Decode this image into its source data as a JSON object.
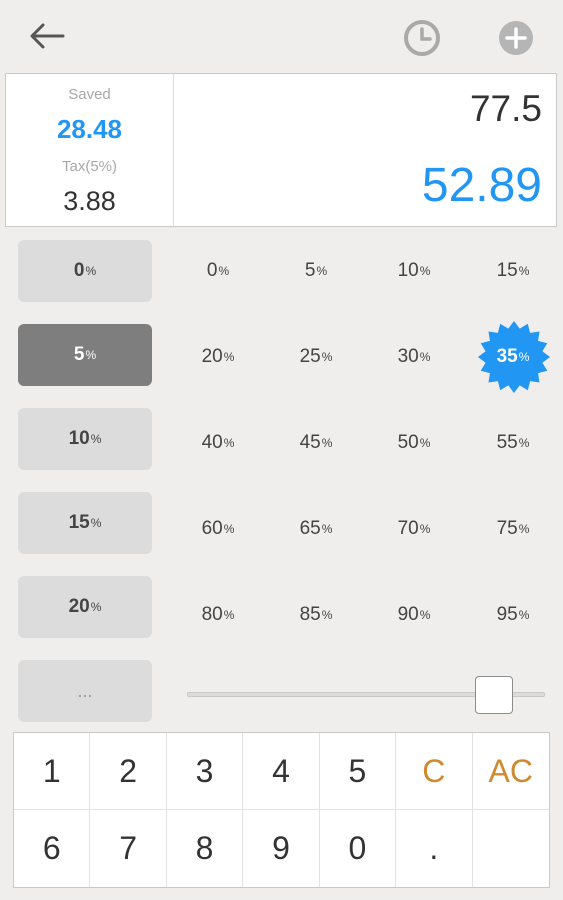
{
  "display": {
    "saved_label": "Saved",
    "saved_value": "28.48",
    "tax_label": "Tax(5%)",
    "tax_value": "3.88",
    "price": "77.5",
    "result": "52.89"
  },
  "tax_rates": [
    {
      "value": "0",
      "unit": "%",
      "selected": false
    },
    {
      "value": "5",
      "unit": "%",
      "selected": true
    },
    {
      "value": "10",
      "unit": "%",
      "selected": false
    },
    {
      "value": "15",
      "unit": "%",
      "selected": false
    },
    {
      "value": "20",
      "unit": "%",
      "selected": false
    }
  ],
  "tax_more_label": "...",
  "discounts": [
    [
      "0",
      "5",
      "10",
      "15"
    ],
    [
      "20",
      "25",
      "30",
      "35"
    ],
    [
      "40",
      "45",
      "50",
      "55"
    ],
    [
      "60",
      "65",
      "70",
      "75"
    ],
    [
      "80",
      "85",
      "90",
      "95"
    ]
  ],
  "selected_discount": "35",
  "percent_symbol": "%",
  "slider_level": 0.9,
  "keypad": {
    "row1": [
      "1",
      "2",
      "3",
      "4",
      "5",
      "C",
      "AC"
    ],
    "row2": [
      "6",
      "7",
      "8",
      "9",
      "0",
      ".",
      ""
    ]
  },
  "colors": {
    "accent": "#2196f3",
    "key_orange": "#d08a2e",
    "selected_tax_bg": "#7e7e7e",
    "background": "#efeeed"
  },
  "icons": [
    "back-arrow-icon",
    "history-clock-icon",
    "add-circle-icon"
  ]
}
